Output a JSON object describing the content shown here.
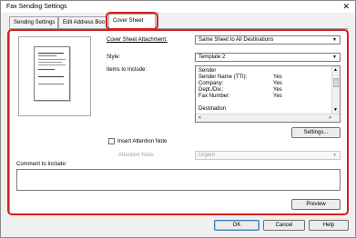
{
  "window": {
    "title": "Fax Sending Settings",
    "close_glyph": "✕"
  },
  "tabs": [
    {
      "label": "Sending Settings"
    },
    {
      "label": "Edit Address Boo"
    },
    {
      "label": "Cover Sheet"
    }
  ],
  "cover_sheet": {
    "attachment_label": "Cover Sheet Attachment:",
    "attachment_value": "Same Sheet to All Destinations",
    "style_label": "Style:",
    "style_value": "Template 2",
    "items_label": "Items to Include:",
    "items": [
      {
        "key": "Sender",
        "value": ""
      },
      {
        "key": "Sender Name (TTI):",
        "value": "Yes"
      },
      {
        "key": "Company:",
        "value": "Yes"
      },
      {
        "key": "Dept./Div.:",
        "value": "Yes"
      },
      {
        "key": "Fax Number:",
        "value": "Yes"
      },
      {
        "key": "",
        "value": ""
      },
      {
        "key": "Destination",
        "value": ""
      }
    ],
    "settings_button": "Settings...",
    "insert_attention_label": "Insert Attention Note",
    "attention_note_label": "Attention Note:",
    "attention_note_value": "Urgent",
    "comment_label": "Comment to Include:",
    "comment_value": "",
    "preview_button": "Preview"
  },
  "footer": {
    "ok": "OK",
    "cancel": "Cancel",
    "help": "Help"
  },
  "glyphs": {
    "dropdown": "▼",
    "scroll_up": "▲",
    "scroll_down": "▼",
    "scroll_left": "<",
    "scroll_right": ">"
  },
  "colors": {
    "highlight": "#d81e1e",
    "window_bg": "#f0f0f0"
  }
}
